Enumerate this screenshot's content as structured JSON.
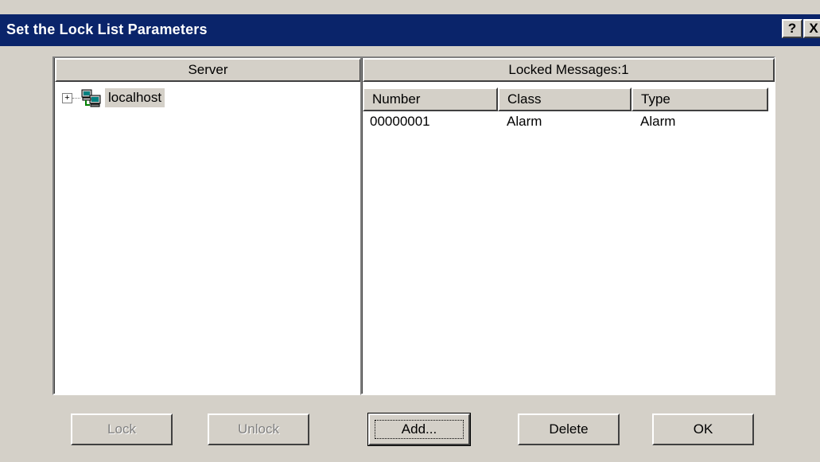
{
  "window": {
    "title": "Set the Lock List Parameters",
    "help_button": "?",
    "close_button": "X"
  },
  "server_panel": {
    "header": "Server",
    "tree": [
      {
        "label": "localhost",
        "expander": "+",
        "icon": "server-computer-icon",
        "selected": true
      }
    ]
  },
  "messages_panel": {
    "header": "Locked Messages:1",
    "columns": [
      "Number",
      "Class",
      "Type"
    ],
    "rows": [
      [
        "00000001",
        "Alarm",
        "Alarm"
      ]
    ]
  },
  "buttons": {
    "lock": "Lock",
    "unlock": "Unlock",
    "add": "Add...",
    "delete": "Delete",
    "ok": "OK"
  },
  "colors": {
    "titlebar": "#0a246a",
    "face": "#d4d0c8",
    "selection": "#d4d0c8"
  }
}
